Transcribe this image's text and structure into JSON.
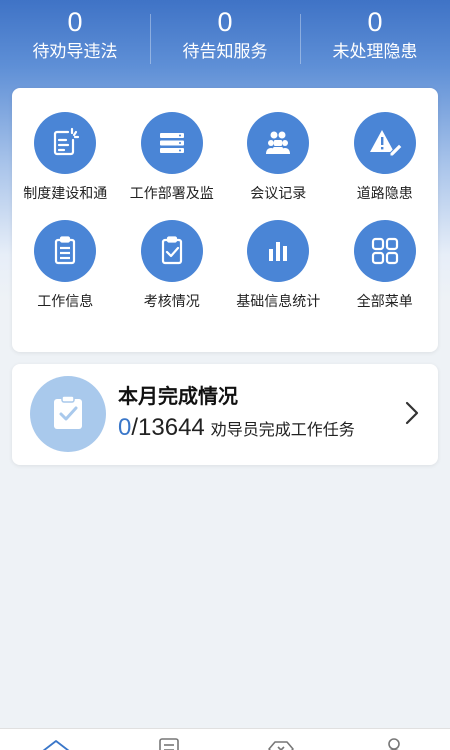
{
  "stats": [
    {
      "value": "0",
      "label": "待劝导违法"
    },
    {
      "value": "0",
      "label": "待告知服务"
    },
    {
      "value": "0",
      "label": "未处理隐患"
    }
  ],
  "menu": {
    "items": [
      {
        "label": "制度建设和通",
        "icon": "document-icon"
      },
      {
        "label": "工作部署及监",
        "icon": "server-icon"
      },
      {
        "label": "会议记录",
        "icon": "meeting-icon"
      },
      {
        "label": "道路隐患",
        "icon": "warning-edit-icon"
      },
      {
        "label": "工作信息",
        "icon": "clipboard-list-icon"
      },
      {
        "label": "考核情况",
        "icon": "clipboard-check-icon"
      },
      {
        "label": "基础信息统计",
        "icon": "bar-chart-icon"
      },
      {
        "label": "全部菜单",
        "icon": "grid-icon"
      }
    ]
  },
  "monthly": {
    "title": "本月完成情况",
    "done": "0",
    "total": "/13644",
    "suffix": "劝导员完成工作任务"
  },
  "colors": {
    "accent": "#4a85d6",
    "done_number": "#3a77c9",
    "header_top": "#3f73c6"
  },
  "tabbar": {
    "tabs": [
      {
        "icon": "home-icon"
      },
      {
        "icon": "list-icon"
      },
      {
        "icon": "hexagon-icon"
      },
      {
        "icon": "user-icon"
      }
    ]
  }
}
